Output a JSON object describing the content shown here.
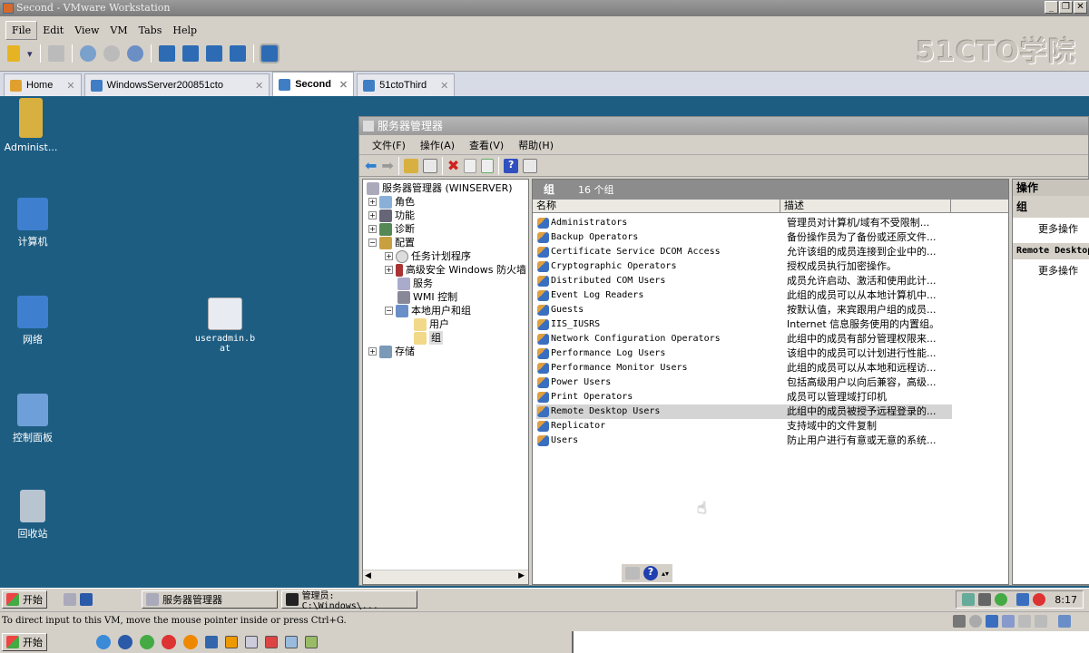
{
  "window": {
    "title": "Second - VMware Workstation",
    "watermark": "51CTO学院"
  },
  "menu": [
    "File",
    "Edit",
    "View",
    "VM",
    "Tabs",
    "Help"
  ],
  "tabs": [
    {
      "label": "Home"
    },
    {
      "label": "WindowsServer200851cto"
    },
    {
      "label": "Second",
      "active": true
    },
    {
      "label": "51ctoThird"
    }
  ],
  "desktop": {
    "icons": [
      "Administ...",
      "计算机",
      "网络",
      "useradmin.bat",
      "控制面板",
      "回收站"
    ]
  },
  "server_manager": {
    "title": "服务器管理器",
    "menu": [
      "文件(F)",
      "操作(A)",
      "查看(V)",
      "帮助(H)"
    ],
    "tree": {
      "root": "服务器管理器 (WINSERVER)",
      "roles": "角色",
      "features": "功能",
      "diagnostics": "诊断",
      "configuration": "配置",
      "task_scheduler": "任务计划程序",
      "firewall": "高级安全 Windows 防火墙",
      "services": "服务",
      "wmi": "WMI 控制",
      "local_users_groups": "本地用户和组",
      "users": "用户",
      "groups": "组",
      "storage": "存储"
    },
    "list": {
      "header": "组",
      "count": "16 个组",
      "col_name": "名称",
      "col_desc": "描述",
      "selected": "Remote Desktop Users",
      "rows": [
        {
          "name": "Administrators",
          "desc": "管理员对计算机/域有不受限制..."
        },
        {
          "name": "Backup Operators",
          "desc": "备份操作员为了备份或还原文件..."
        },
        {
          "name": "Certificate Service DCOM Access",
          "desc": "允许该组的成员连接到企业中的..."
        },
        {
          "name": "Cryptographic Operators",
          "desc": "授权成员执行加密操作。"
        },
        {
          "name": "Distributed COM Users",
          "desc": "成员允许启动、激活和使用此计..."
        },
        {
          "name": "Event Log Readers",
          "desc": "此组的成员可以从本地计算机中..."
        },
        {
          "name": "Guests",
          "desc": "按默认值，来宾跟用户组的成员..."
        },
        {
          "name": "IIS_IUSRS",
          "desc": "Internet 信息服务使用的内置组。"
        },
        {
          "name": "Network Configuration Operators",
          "desc": "此组中的成员有部分管理权限来..."
        },
        {
          "name": "Performance Log Users",
          "desc": "该组中的成员可以计划进行性能..."
        },
        {
          "name": "Performance Monitor Users",
          "desc": "此组的成员可以从本地和远程访..."
        },
        {
          "name": "Power Users",
          "desc": "包括高级用户以向后兼容，高级..."
        },
        {
          "name": "Print Operators",
          "desc": "成员可以管理域打印机"
        },
        {
          "name": "Remote Desktop Users",
          "desc": "此组中的成员被授予远程登录的..."
        },
        {
          "name": "Replicator",
          "desc": "支持域中的文件复制"
        },
        {
          "name": "Users",
          "desc": "防止用户进行有意或无意的系统..."
        }
      ]
    },
    "actions": {
      "title": "操作",
      "section1": "组",
      "more1": "更多操作",
      "section2": "Remote Desktop Users",
      "more2": "更多操作"
    }
  },
  "guest_taskbar": {
    "start": "开始",
    "items": [
      "服务器管理器",
      "管理员: C:\\Windows\\..."
    ],
    "clock": "8:17"
  },
  "status_bar": "To direct input to this VM, move the mouse pointer inside or press Ctrl+G.",
  "host_taskbar": {
    "start": "开始"
  }
}
